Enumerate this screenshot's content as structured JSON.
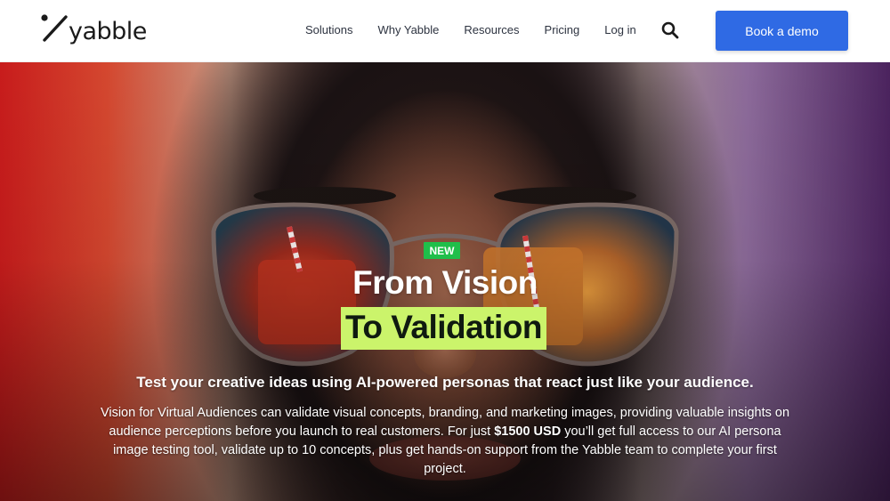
{
  "header": {
    "logo_text": "yabble",
    "nav": [
      "Solutions",
      "Why Yabble",
      "Resources",
      "Pricing",
      "Log in"
    ],
    "cta_label": "Book a demo",
    "search_icon": "search-icon"
  },
  "hero": {
    "badge": "NEW",
    "title_line1": "From Vision",
    "title_line2": "To Validation",
    "subtitle": "Test your creative ideas using AI-powered personas that react just like your audience.",
    "body_before": "Vision for Virtual Audiences can validate visual concepts, branding, and marketing images, providing valuable insights on audience perceptions before you launch to real customers. For just ",
    "body_price": "$1500 USD",
    "body_after": " you’ll get full access to our AI persona image testing tool, validate up to 10 concepts, plus get hands-on support from the Yabble team to complete your first project."
  },
  "colors": {
    "accent": "#2f6ae4",
    "badge": "#1fbf4a",
    "highlight": "#cbf46b"
  }
}
